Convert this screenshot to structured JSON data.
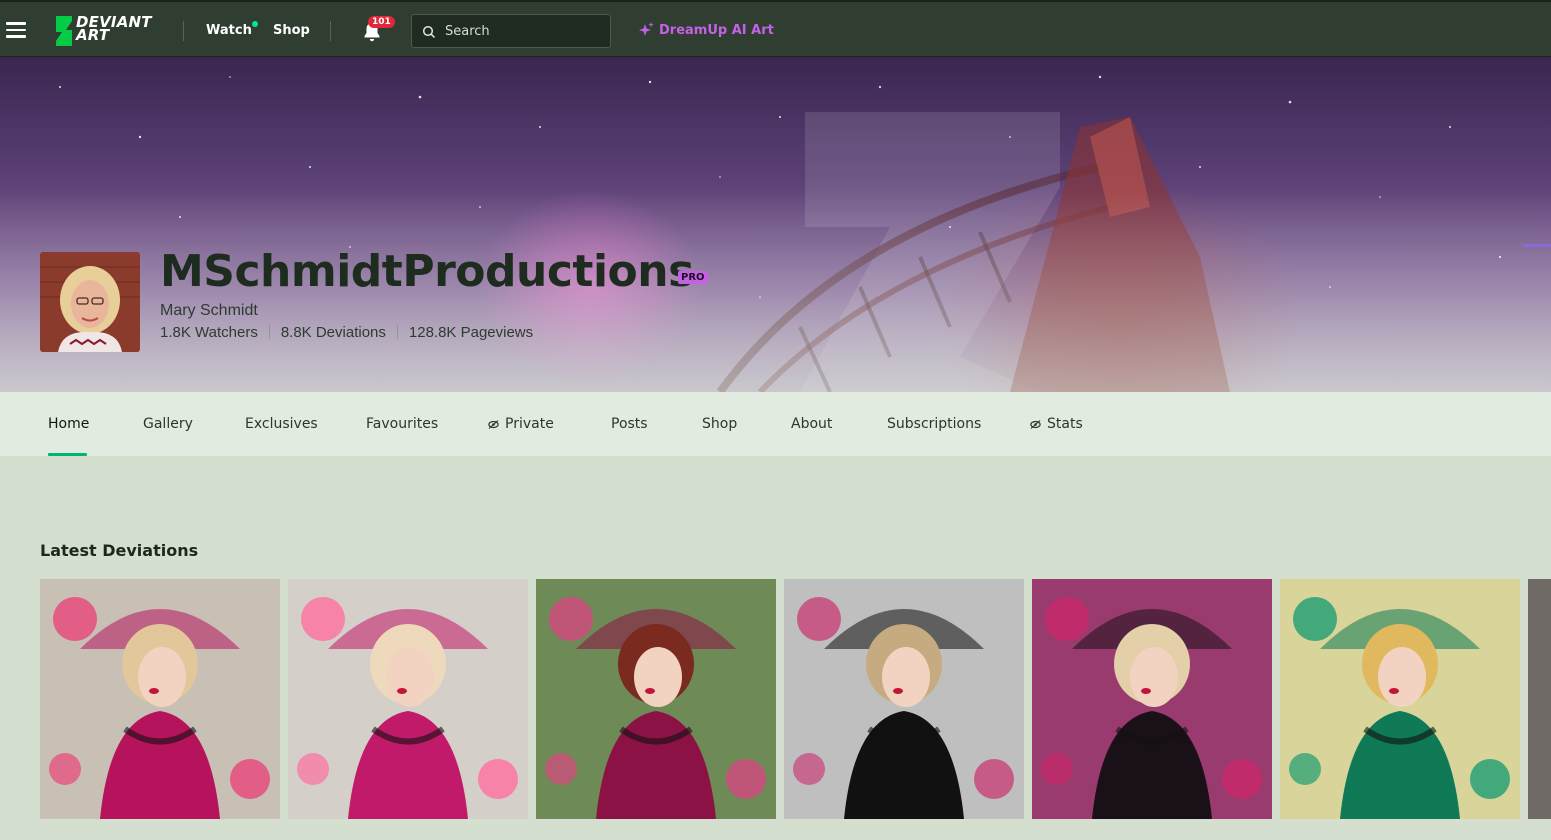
{
  "header": {
    "logo_line1": "DEVIANT",
    "logo_line2": "ART",
    "watch_label": "Watch",
    "shop_label": "Shop",
    "notification_count": "101",
    "search_placeholder": "Search",
    "dreamup_label": "DreamUp AI Art"
  },
  "profile": {
    "username": "MSchmidtProductions",
    "badge": "PRO",
    "real_name": "Mary Schmidt",
    "watchers": "1.8K Watchers",
    "deviations": "8.8K Deviations",
    "pageviews": "128.8K Pageviews"
  },
  "tabs": [
    {
      "label": "Home",
      "active": true
    },
    {
      "label": "Gallery"
    },
    {
      "label": "Exclusives"
    },
    {
      "label": "Favourites"
    },
    {
      "label": "Private",
      "icon": "eye-off-icon"
    },
    {
      "label": "Posts"
    },
    {
      "label": "Shop"
    },
    {
      "label": "About"
    },
    {
      "label": "Subscriptions"
    },
    {
      "label": "Stats",
      "icon": "eye-off-icon"
    }
  ],
  "latest": {
    "title": "Latest Deviations",
    "items": [
      {
        "bg": "#c8bfb5",
        "dress": "#b5145c",
        "accent": "#e8467a",
        "hair": "#e2c79a"
      },
      {
        "bg": "#d4cfc8",
        "dress": "#c21a6a",
        "accent": "#ff6fa0",
        "hair": "#efd9bd"
      },
      {
        "bg": "#6e8a56",
        "dress": "#8c1246",
        "accent": "#d5487f",
        "hair": "#7a2a1f"
      },
      {
        "bg": "#bfbfbf",
        "dress": "#111111",
        "accent": "#c9427a",
        "hair": "#c6ab80"
      },
      {
        "bg": "#9a3b6f",
        "dress": "#1a1018",
        "accent": "#c8286a",
        "hair": "#e3cfa8"
      },
      {
        "bg": "#d8d49a",
        "dress": "#0f7a55",
        "accent": "#1f9e72",
        "hair": "#e0b95e"
      }
    ]
  },
  "colors": {
    "topbar": "#2f3e30",
    "accent_green": "#00b574",
    "pro_purple": "#c462e6",
    "notification_red": "#e3273a"
  }
}
